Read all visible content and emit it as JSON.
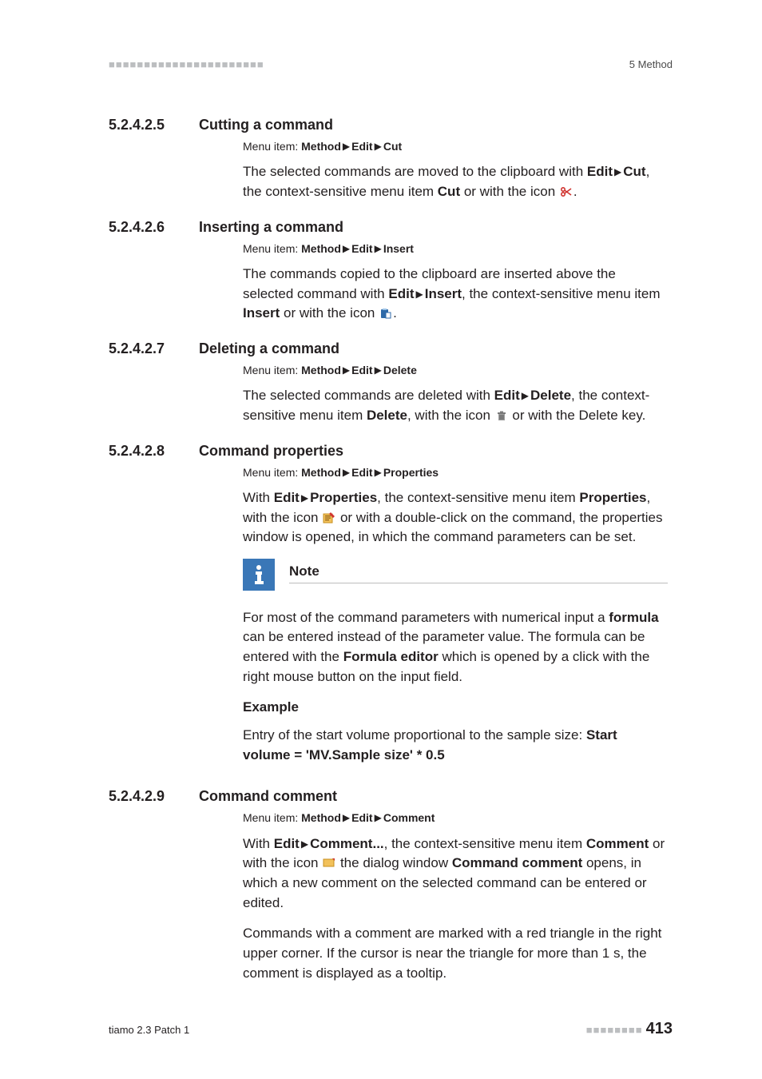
{
  "header": {
    "dashes": "■■■■■■■■■■■■■■■■■■■■■■",
    "right": "5 Method"
  },
  "menu_prefix": "Menu item: ",
  "menu_method": "Method",
  "menu_edit": "Edit",
  "sections": {
    "s525": {
      "num": "5.2.4.2.5",
      "title": "Cutting a command",
      "menu_last": "Cut",
      "p1_a": "The selected commands are moved to the clipboard with ",
      "p1_b": "Edit",
      "p1_c": "Cut",
      "p1_d": ", the context-sensitive menu item ",
      "p1_e": "Cut",
      "p1_f": " or with the icon ",
      "p1_g": "."
    },
    "s526": {
      "num": "5.2.4.2.6",
      "title": "Inserting a command",
      "menu_last": "Insert",
      "p1_a": "The commands copied to the clipboard are inserted above the selected command with ",
      "p1_b": "Edit",
      "p1_c": "Insert",
      "p1_d": ", the context-sensitive menu item ",
      "p1_e": "Insert",
      "p1_f": " or with the icon ",
      "p1_g": "."
    },
    "s527": {
      "num": "5.2.4.2.7",
      "title": "Deleting a command",
      "menu_last": "Delete",
      "p1_a": "The selected commands are deleted with ",
      "p1_b": "Edit",
      "p1_c": "Delete",
      "p1_d": ", the context-sensitive menu item ",
      "p1_e": "Delete",
      "p1_f": ", with the icon ",
      "p1_g": " or with the Delete key."
    },
    "s528": {
      "num": "5.2.4.2.8",
      "title": "Command properties",
      "menu_last": "Properties",
      "p1_a": "With ",
      "p1_b": "Edit",
      "p1_c": "Properties",
      "p1_d": ", the context-sensitive menu item ",
      "p1_e": "Properties",
      "p1_f": ", with the icon ",
      "p1_g": " or with a double-click on the command, the properties window is opened, in which the command parameters can be set."
    },
    "note": {
      "title": "Note",
      "p1_a": "For most of the command parameters with numerical input a ",
      "p1_b": "formula",
      "p1_c": " can be entered instead of the parameter value. The formula can be entered with the ",
      "p1_d": "Formula editor",
      "p1_e": " which is opened by a click with the right mouse button on the input field.",
      "ex_head": "Example",
      "ex_a": "Entry of the start volume proportional to the sample size: ",
      "ex_b": "Start volume = 'MV.Sample size' * 0.5"
    },
    "s529": {
      "num": "5.2.4.2.9",
      "title": "Command comment",
      "menu_last": "Comment",
      "p1_a": "With ",
      "p1_b": "Edit",
      "p1_c": "Comment...",
      "p1_d": ", the context-sensitive menu item ",
      "p1_e": "Comment",
      "p1_f": " or with the icon ",
      "p1_g": " the dialog window ",
      "p1_h": "Command comment",
      "p1_i": " opens, in which a new comment on the selected command can be entered or edited.",
      "p2": "Commands with a comment are marked with a red triangle in the right upper corner. If the cursor is near the triangle for more than 1 s, the comment is displayed as a tooltip."
    }
  },
  "footer": {
    "left": "tiamo 2.3 Patch 1",
    "dashes": "■■■■■■■■",
    "page": "413"
  }
}
